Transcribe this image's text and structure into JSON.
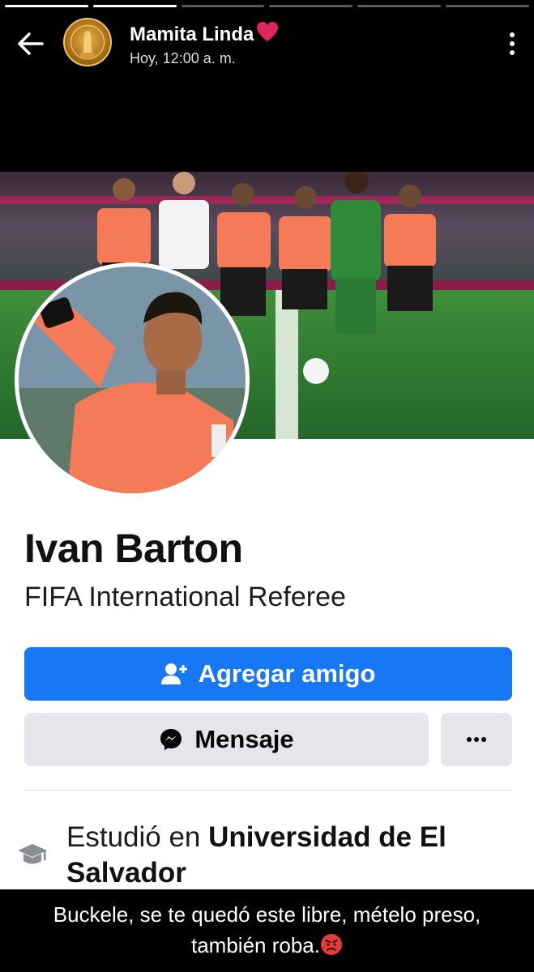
{
  "story": {
    "progress_segments": 6,
    "progress_done": 2,
    "poster_name": "Mamita Linda",
    "poster_emoji": "red-heart-icon",
    "timestamp": "Hoy, 12:00 a. m.",
    "caption_line1": "Buckele, se te quedó este libre, mételo preso,",
    "caption_line2": "también roba.",
    "caption_emoji": "angry-face-icon"
  },
  "profile": {
    "name": "Ivan Barton",
    "bio": "FIFA International Referee",
    "add_friend_label": "Agregar amigo",
    "message_label": "Mensaje",
    "more_label": "···",
    "education_prefix": "Estudió en ",
    "education_school": "Universidad de El Salvador"
  },
  "colors": {
    "facebook_blue": "#1877f2",
    "secondary_button": "#e4e6eb",
    "referee_shirt": "#f57a58",
    "pitch_green": "#2e7a2e"
  }
}
